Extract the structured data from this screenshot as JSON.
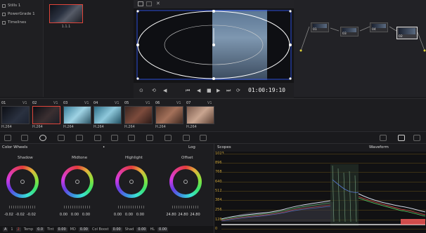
{
  "gallery": {
    "items": [
      {
        "label": "Stills 1"
      },
      {
        "label": "PowerGrade 1"
      },
      {
        "label": "Timelines"
      }
    ],
    "still_label": "1.1.1"
  },
  "viewer": {
    "timecode": "01:00:19:10"
  },
  "nodes": [
    {
      "label": "01"
    },
    {
      "label": "03"
    },
    {
      "label": "04"
    },
    {
      "label": "02"
    }
  ],
  "clips": [
    {
      "num": "01",
      "track": "V1",
      "codec": "H.264"
    },
    {
      "num": "02",
      "track": "V1",
      "codec": "H.264"
    },
    {
      "num": "03",
      "track": "V1",
      "codec": "H.264"
    },
    {
      "num": "04",
      "track": "V1",
      "codec": "H.264"
    },
    {
      "num": "05",
      "track": "V1",
      "codec": "H.264"
    },
    {
      "num": "06",
      "track": "V1",
      "codec": "H.264"
    },
    {
      "num": "07",
      "track": "V1",
      "codec": "H.264"
    }
  ],
  "color_wheels": {
    "title": "Color Wheels",
    "mode": "Log",
    "wheels": [
      {
        "name": "Shadow",
        "values": [
          "-0.02",
          "-0.02",
          "-0.02"
        ]
      },
      {
        "name": "Midtone",
        "values": [
          "0.00",
          "0.00",
          "0.00"
        ]
      },
      {
        "name": "Highlight",
        "values": [
          "0.00",
          "0.00",
          "0.00"
        ]
      },
      {
        "name": "Offset",
        "values": [
          "24.80",
          "24.80",
          "24.80"
        ]
      }
    ],
    "footer": {
      "a_label": "A",
      "page1": "1",
      "page2": "2",
      "temp_label": "Temp",
      "temp_value": "0.0",
      "tint_label": "Tint",
      "tint_value": "0.00",
      "md_label": "MD",
      "md_value": "0.00",
      "colboost_label": "Col Boost",
      "colboost_value": "0.00",
      "shad_label": "Shad",
      "shad_value": "0.00",
      "hl_label": "HL",
      "hl_value": "0.00"
    }
  },
  "scopes": {
    "title": "Scopes",
    "mode": "Waveform",
    "scale": [
      "1023",
      "896",
      "768",
      "640",
      "512",
      "384",
      "256",
      "128",
      "0"
    ]
  }
}
